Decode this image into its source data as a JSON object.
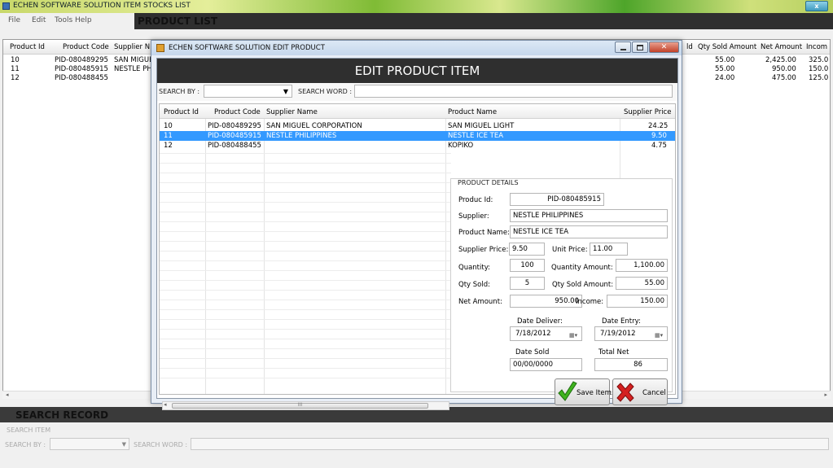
{
  "main": {
    "title": "ECHEN SOFTWARE SOLUTION ITEM STOCKS LIST",
    "close_glyph": "x",
    "menu": [
      "File",
      "Edit",
      "Tools Help"
    ],
    "product_list_header": "PRODUCT LIST",
    "columns": [
      "Product Id",
      "Product Code",
      "Supplier N",
      "Qty Sold Amount",
      "Net Amount",
      "Incom"
    ],
    "right_cols_partial": "ld",
    "rows": [
      {
        "id": "10",
        "code": "PID-080489295",
        "supplier": "SAN MIGUE",
        "qty_sold_amount": "55.00",
        "net_amount": "2,425.00",
        "income": "325.0"
      },
      {
        "id": "11",
        "code": "PID-080485915",
        "supplier": "NESTLE PHI",
        "qty_sold_amount": "55.00",
        "net_amount": "950.00",
        "income": "150.0"
      },
      {
        "id": "12",
        "code": "PID-080488455",
        "supplier": "",
        "qty_sold_amount": "24.00",
        "net_amount": "475.00",
        "income": "125.0"
      }
    ],
    "search_record": {
      "header": "SEARCH RECORD",
      "search_item_label": "SEARCH ITEM",
      "search_by_label": "SEARCH BY :",
      "search_word_label": "SEARCH WORD :",
      "search_by_value": "",
      "search_word_value": ""
    }
  },
  "dialog": {
    "title": "ECHEN SOFTWARE SOLUTION EDIT PRODUCT",
    "header": "EDIT PRODUCT ITEM",
    "search_by_label": "SEARCH BY :",
    "search_by_value": "",
    "search_word_label": "SEARCH WORD :",
    "search_word_value": "",
    "columns": [
      "Product Id",
      "Product Code",
      "Supplier Name",
      "Product Name",
      "Supplier Price"
    ],
    "rows": [
      {
        "id": "10",
        "code": "PID-080489295",
        "supplier": "SAN MIGUEL CORPORATION",
        "product": "SAN MIGUEL LIGHT",
        "price": "24.25"
      },
      {
        "id": "11",
        "code": "PID-080485915",
        "supplier": "NESTLE PHILIPPINES",
        "product": "NESTLE ICE TEA",
        "price": "9.50"
      },
      {
        "id": "12",
        "code": "PID-080488455",
        "supplier": "",
        "product": "KOPIKO",
        "price": "4.75"
      }
    ],
    "selected_row": 1,
    "scroll_mark": "III",
    "details": {
      "legend": "PRODUCT DETAILS",
      "product_id_label": "Produc Id:",
      "product_id": "PID-080485915",
      "supplier_label": "Supplier:",
      "supplier": "NESTLE PHILIPPINES",
      "product_name_label": "Product Name:",
      "product_name": "NESTLE ICE TEA",
      "supplier_price_label": "Supplier Price:",
      "supplier_price": "9.50",
      "unit_price_label": "Unit Price:",
      "unit_price": "11.00",
      "quantity_label": "Quantity:",
      "quantity": "100",
      "quantity_amount_label": "Quantity Amount:",
      "quantity_amount": "1,100.00",
      "qty_sold_label": "Qty Sold:",
      "qty_sold": "5",
      "qty_sold_amount_label": "Qty Sold Amount:",
      "qty_sold_amount": "55.00",
      "net_amount_label": "Net Amount:",
      "net_amount": "950.00",
      "income_label": "Income:",
      "income": "150.00",
      "date_deliver_label": "Date Deliver:",
      "date_deliver": "7/18/2012",
      "date_entry_label": "Date Entry:",
      "date_entry": "7/19/2012",
      "date_sold_label": "Date Sold",
      "date_sold": "00/00/0000",
      "total_net_label": "Total Net",
      "total_net": "86",
      "save_label": "Save Item",
      "cancel_label": "Cancel"
    }
  },
  "colors": {
    "selection": "#3399ff",
    "header_dark": "#2f2f2f",
    "save_check": "#3fb31f",
    "cancel_x": "#d42020"
  }
}
